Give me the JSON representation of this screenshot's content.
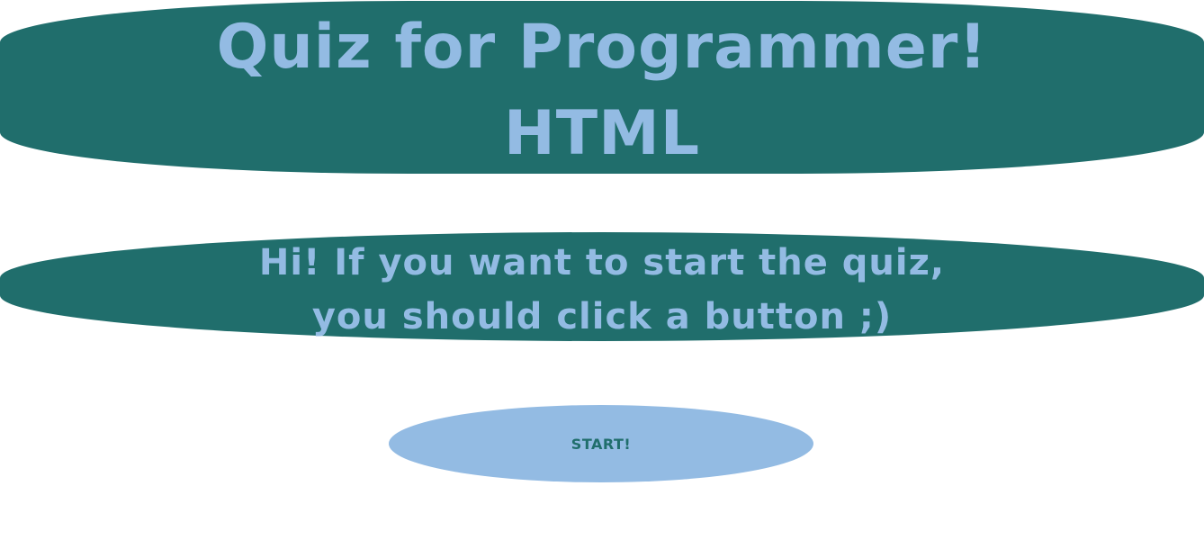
{
  "header": {
    "title_line_1": "Quiz for Programmer!",
    "title_line_2": "HTML"
  },
  "intro": {
    "line_1": "Hi! If you want to start the quiz,",
    "line_2": "you should click a button ;)"
  },
  "start_button": {
    "label": "START!"
  },
  "colors": {
    "banner_background": "#206e6c",
    "banner_text": "#93bbe3",
    "button_background": "#93bbe3",
    "button_text": "#206e6c",
    "page_background": "#ffffff"
  }
}
